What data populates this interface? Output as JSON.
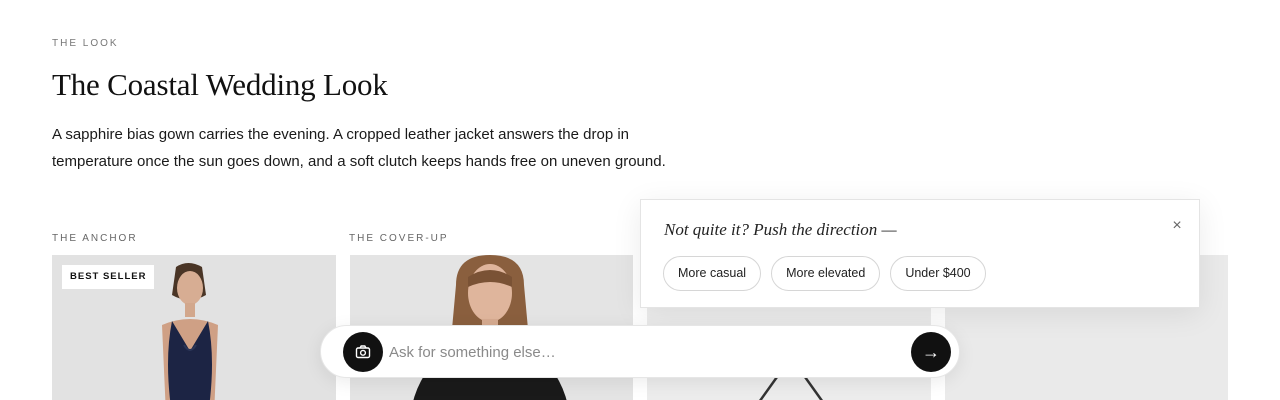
{
  "look": {
    "eyebrow": "THE LOOK",
    "title": "The Coastal Wedding Look",
    "description": "A sapphire bias gown carries the evening. A cropped leather jacket answers the drop in temperature once the sun goes down, and a soft clutch keeps hands free on uneven ground."
  },
  "products": [
    {
      "label": "THE ANCHOR",
      "badge": "BEST SELLER"
    },
    {
      "label": "THE COVER-UP"
    },
    {
      "label": ""
    },
    {
      "label": ""
    }
  ],
  "suggestions": {
    "title": "Not quite it? Push the direction —",
    "close_label": "×",
    "chips": [
      "More casual",
      "More elevated",
      "Under $400"
    ]
  },
  "ask": {
    "placeholder": "Ask for something else…",
    "camera_icon": "camera-icon",
    "send_icon": "arrow-right-icon",
    "send_label": "→"
  }
}
